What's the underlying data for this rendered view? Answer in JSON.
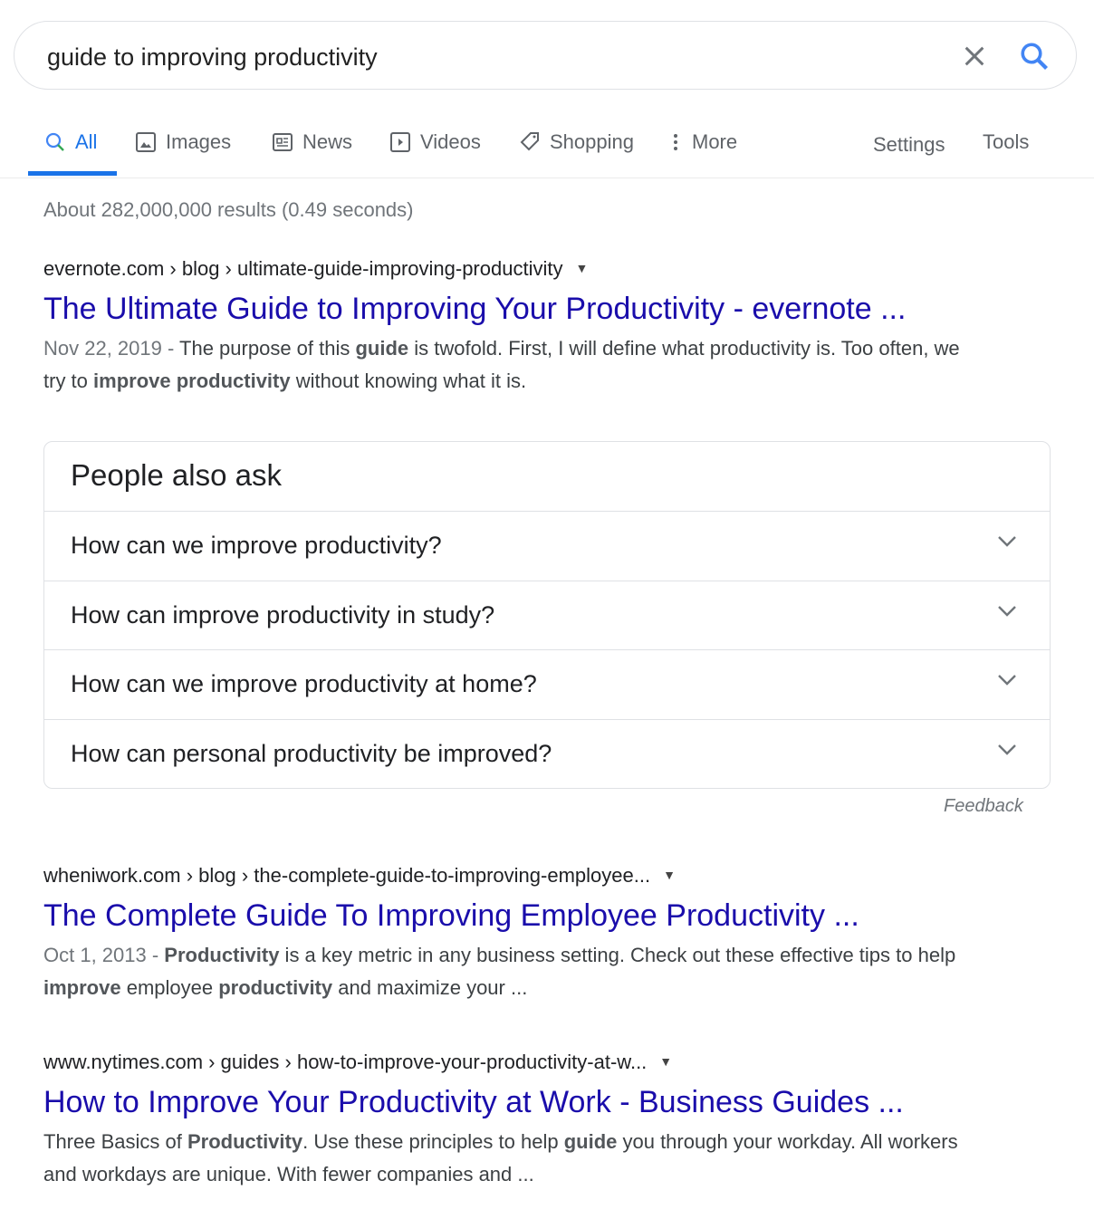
{
  "search": {
    "query": "guide to improving productivity"
  },
  "tabs": [
    {
      "label": "All",
      "icon": "search-icon"
    },
    {
      "label": "Images",
      "icon": "image-icon"
    },
    {
      "label": "News",
      "icon": "news-icon"
    },
    {
      "label": "Videos",
      "icon": "play-icon"
    },
    {
      "label": "Shopping",
      "icon": "tag-icon"
    },
    {
      "label": "More",
      "icon": "more-vert-icon"
    }
  ],
  "tools": {
    "settings": "Settings",
    "tools": "Tools"
  },
  "stats": "About 282,000,000 results (0.49 seconds)",
  "results": [
    {
      "cite": "evernote.com › blog › ultimate-guide-improving-productivity",
      "title": "The Ultimate Guide to Improving Your Productivity - evernote ...",
      "date": "Nov 22, 2019 - ",
      "snippet": [
        [
          "The purpose of this ",
          0
        ],
        [
          "guide",
          1
        ],
        [
          " is twofold. First, I will define what productivity is. Too often, we try to ",
          0
        ],
        [
          "improve productivity",
          1
        ],
        [
          " without knowing what it is.",
          0
        ]
      ]
    },
    {
      "cite": "wheniwork.com › blog › the-complete-guide-to-improving-employee...",
      "title": "The Complete Guide To Improving Employee Productivity ...",
      "date": "Oct 1, 2013 - ",
      "snippet": [
        [
          "Productivity",
          1
        ],
        [
          " is a key metric in any business setting. Check out these effective tips to help ",
          0
        ],
        [
          "improve",
          1
        ],
        [
          " employee ",
          0
        ],
        [
          "productivity",
          1
        ],
        [
          " and maximize your ...",
          0
        ]
      ]
    },
    {
      "cite": "www.nytimes.com › guides › how-to-improve-your-productivity-at-w...",
      "title": "How to Improve Your Productivity at Work - Business Guides ...",
      "date": "",
      "snippet": [
        [
          "Three Basics of ",
          0
        ],
        [
          "Productivity",
          1
        ],
        [
          ". Use these principles to help ",
          0
        ],
        [
          "guide",
          1
        ],
        [
          " you through your workday. All workers and workdays are unique. With fewer companies and ...",
          0
        ]
      ]
    }
  ],
  "paa": {
    "heading": "People also ask",
    "questions": [
      "How can we improve productivity?",
      "How can improve productivity in study?",
      "How can we improve productivity at home?",
      "How can personal productivity be improved?"
    ],
    "feedback": "Feedback"
  },
  "colors": {
    "link": "#1a0dab",
    "accent": "#1a73e8"
  }
}
